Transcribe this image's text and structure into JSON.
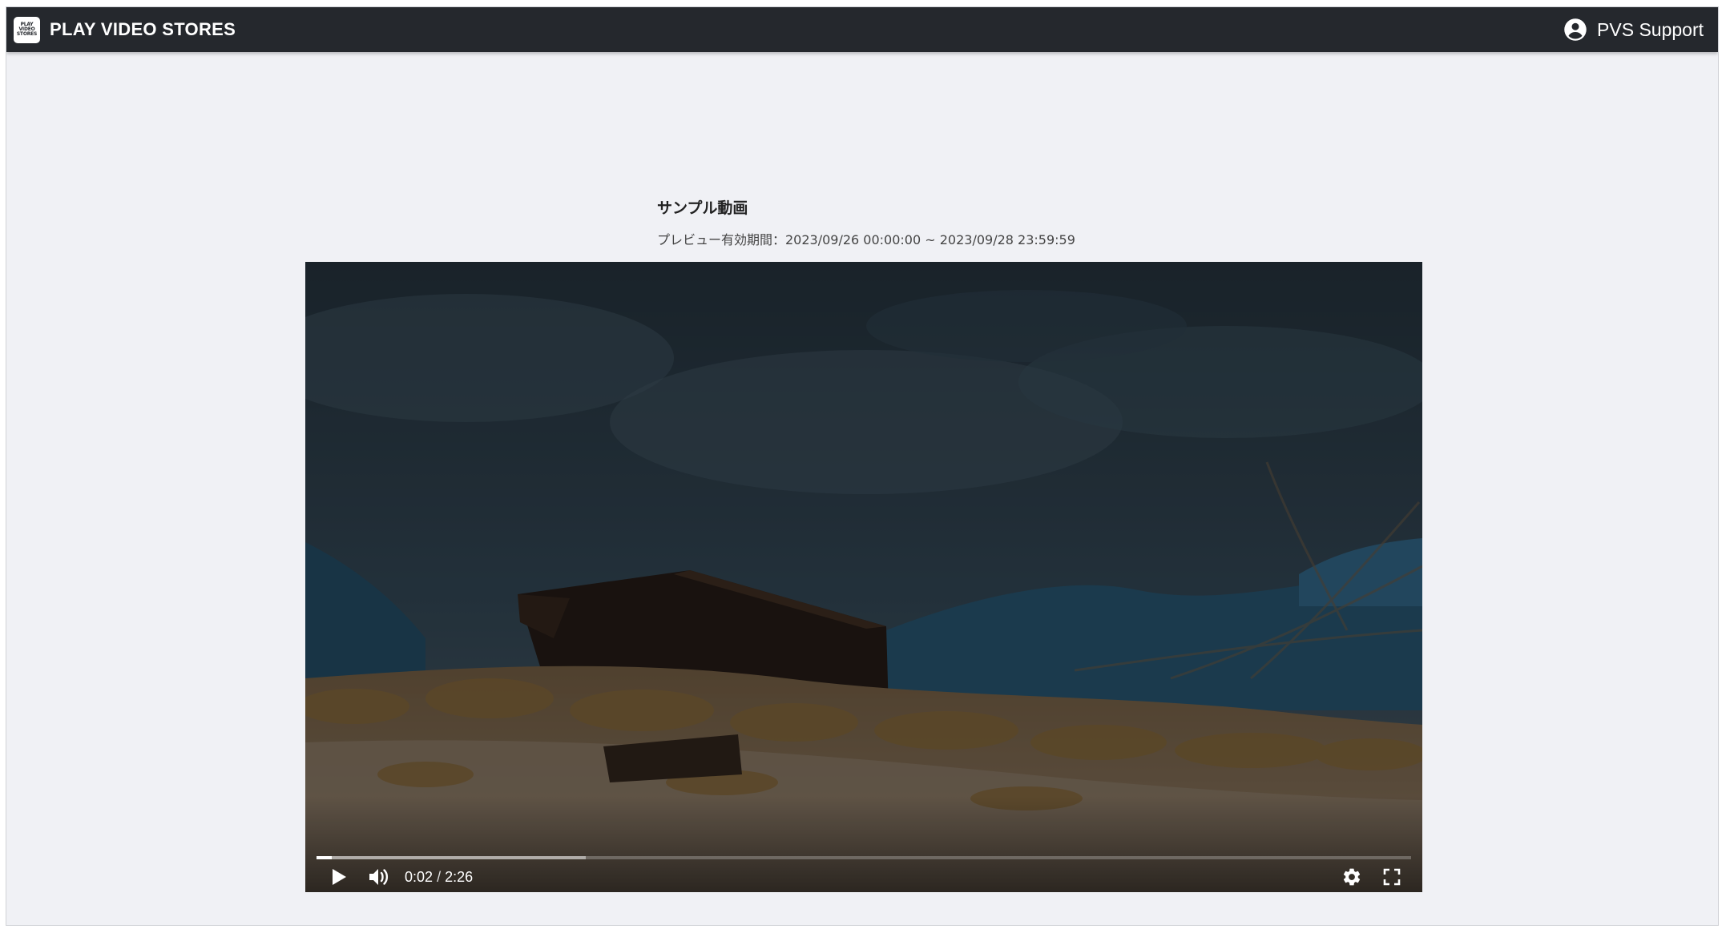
{
  "navbar": {
    "brand_name": "PLAY VIDEO STORES",
    "logo_lines": [
      "PLAY",
      "VIDEO",
      "STORES"
    ],
    "user_name": "PVS Support",
    "icon": "account-circle-icon"
  },
  "video": {
    "title": "サンプル動画",
    "preview_period": "プレビュー有効期間：2023/09/26 00:00:00 ~ 2023/09/28 23:59:59"
  },
  "player": {
    "current_time": "0:02",
    "separator": "/",
    "duration": "2:26",
    "played_fraction": 0.0137,
    "buffered_fraction": 0.246,
    "icons": {
      "play": "play-icon",
      "volume": "volume-icon",
      "settings": "gear-icon",
      "fullscreen": "fullscreen-icon"
    }
  },
  "colors": {
    "navbar_bg": "#25282d",
    "page_bg": "#f0f1f5",
    "text_primary": "#222222",
    "text_secondary": "#444444"
  }
}
